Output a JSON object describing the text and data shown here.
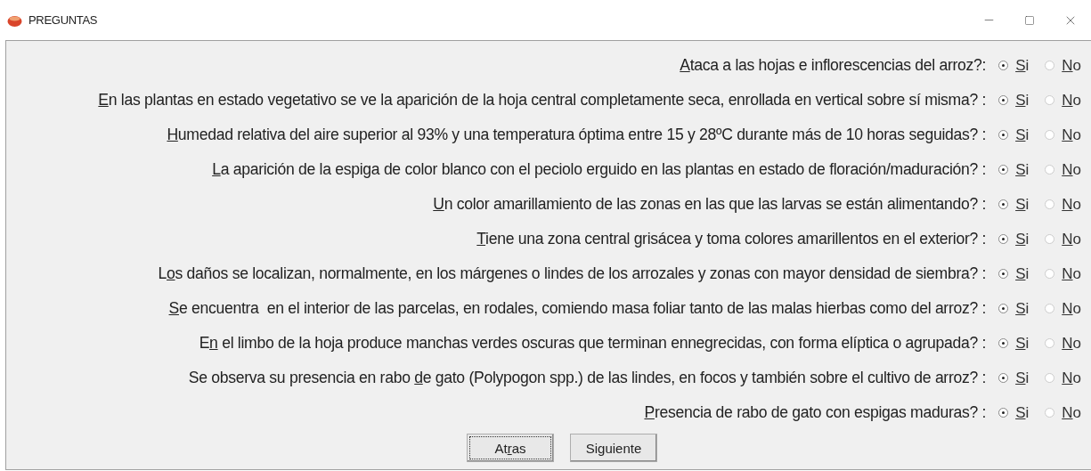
{
  "window": {
    "title": "PREGUNTAS"
  },
  "questions": [
    {
      "access_key": "A",
      "label_post": "taca a las hojas e inflorescencias del arroz?:",
      "options": [
        {
          "key": "S",
          "post": "i",
          "selected": true
        },
        {
          "key": "N",
          "post": "o",
          "selected": false
        }
      ]
    },
    {
      "access_key": "E",
      "label_post": "n las plantas en estado vegetativo se ve la aparición de la hoja central completamente seca, enrollada en vertical sobre sí misma? :",
      "options": [
        {
          "key": "S",
          "post": "i",
          "selected": true
        },
        {
          "key": "N",
          "post": "o",
          "selected": false
        }
      ]
    },
    {
      "access_key": "H",
      "label_post": "umedad relativa del aire superior al 93% y una temperatura óptima entre 15 y 28ºC durante más de 10 horas seguidas? :",
      "options": [
        {
          "key": "S",
          "post": "i",
          "selected": true
        },
        {
          "key": "N",
          "post": "o",
          "selected": false
        }
      ]
    },
    {
      "access_key": "L",
      "label_post": "a aparición de la espiga de color blanco con el peciolo erguido en las plantas en estado de floración/maduración? :",
      "options": [
        {
          "key": "S",
          "post": "i",
          "selected": true
        },
        {
          "key": "N",
          "post": "o",
          "selected": false
        }
      ]
    },
    {
      "access_key": "U",
      "label_post": "n color amarillamiento de las zonas en las que las larvas se están alimentando? :",
      "options": [
        {
          "key": "S",
          "post": "i",
          "selected": true
        },
        {
          "key": "N",
          "post": "o",
          "selected": false
        }
      ]
    },
    {
      "access_key": "T",
      "label_post": "iene una zona central grisácea y toma colores amarillentos en el exterior? :",
      "options": [
        {
          "key": "S",
          "post": "i",
          "selected": true
        },
        {
          "key": "N",
          "post": "o",
          "selected": false
        }
      ]
    },
    {
      "label_pre": "L",
      "access_key": "o",
      "label_post": "s daños se localizan, normalmente, en los márgenes o lindes de los arrozales y zonas con mayor densidad de siembra? :",
      "options": [
        {
          "key": "S",
          "post": "i",
          "selected": true
        },
        {
          "key": "N",
          "post": "o",
          "selected": false
        }
      ]
    },
    {
      "access_key": "S",
      "label_post": "e encuentra  en el interior de las parcelas, en rodales, comiendo masa foliar tanto de las malas hierbas como del arroz? :",
      "options": [
        {
          "key": "S",
          "post": "i",
          "selected": true
        },
        {
          "key": "N",
          "post": "o",
          "selected": false
        }
      ]
    },
    {
      "label_pre": "E",
      "access_key": "n",
      "label_post": " el limbo de la hoja produce manchas verdes oscuras que terminan ennegrecidas, con forma elíptica o agrupada? :",
      "options": [
        {
          "key": "S",
          "post": "i",
          "selected": true
        },
        {
          "key": "N",
          "post": "o",
          "selected": false
        }
      ]
    },
    {
      "label_pre": "Se observa su presencia en rabo ",
      "access_key": "d",
      "label_post": "e gato (Polypogon spp.) de las lindes, en focos y también sobre el cultivo de arroz? :",
      "options": [
        {
          "key": "S",
          "post": "i",
          "selected": true
        },
        {
          "key": "N",
          "post": "o",
          "selected": false
        }
      ]
    },
    {
      "access_key": "P",
      "label_post": "resencia de rabo de gato con espigas maduras? :",
      "options": [
        {
          "key": "S",
          "post": "i",
          "selected": true
        },
        {
          "key": "N",
          "post": "o",
          "selected": false
        }
      ]
    }
  ],
  "buttons": [
    {
      "pre": "At",
      "key": "r",
      "post": "as",
      "focused": true
    },
    {
      "pre": "Si",
      "key": "g",
      "post": "uiente",
      "focused": false
    }
  ]
}
